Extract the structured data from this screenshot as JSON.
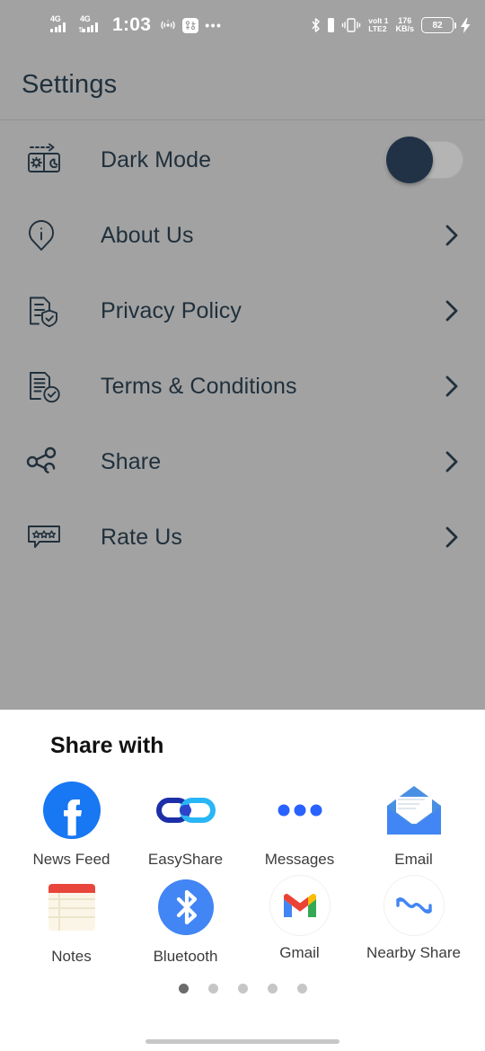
{
  "status_bar": {
    "network_type_1": "4G",
    "network_type_2": "4G",
    "time": "1:03",
    "hotspot_icon": "hotspot-icon",
    "filter_icon": "data-saver-icon",
    "overflow_icon": "more-dots-icon",
    "bluetooth_icon": "bluetooth-icon",
    "vibrate_icon": "vibrate-icon",
    "volte_line1": "volt 1",
    "volte_line2": "LTE2",
    "speed_value": "176",
    "speed_unit": "KB/s",
    "battery_level": "82",
    "charging_icon": "charging-bolt-icon"
  },
  "header": {
    "title": "Settings"
  },
  "settings": {
    "items": [
      {
        "label": "Dark Mode",
        "icon": "dark-mode-icon",
        "control": "toggle",
        "toggle_on": false
      },
      {
        "label": "About Us",
        "icon": "info-pin-icon",
        "control": "chevron"
      },
      {
        "label": "Privacy Policy",
        "icon": "privacy-shield-icon",
        "control": "chevron"
      },
      {
        "label": "Terms & Conditions",
        "icon": "terms-check-icon",
        "control": "chevron"
      },
      {
        "label": "Share",
        "icon": "share-nodes-icon",
        "control": "chevron"
      },
      {
        "label": "Rate Us",
        "icon": "rate-stars-icon",
        "control": "chevron"
      }
    ]
  },
  "share_sheet": {
    "title": "Share with",
    "targets": [
      {
        "label": "News Feed",
        "icon": "facebook-icon"
      },
      {
        "label": "EasyShare",
        "icon": "easyshare-icon"
      },
      {
        "label": "Messages",
        "icon": "messages-dots-icon"
      },
      {
        "label": "Email",
        "icon": "email-envelope-icon"
      },
      {
        "label": "Notes",
        "icon": "notes-icon"
      },
      {
        "label": "Bluetooth",
        "icon": "bluetooth-circle-icon"
      },
      {
        "label": "Gmail",
        "icon": "gmail-icon"
      },
      {
        "label": "Nearby Share",
        "icon": "nearby-share-icon"
      }
    ],
    "page_count": 5,
    "active_page": 1
  },
  "colors": {
    "dim_background": "#a2a2a2",
    "text_dark": "#20303c",
    "toggle_knob": "#213246",
    "toggle_track": "#b4b4b4",
    "facebook_blue": "#1877F2",
    "bluetooth_blue": "#4285F4",
    "email_blue": "#4A90E2",
    "notes_red": "#E8453C",
    "sheet_background": "#ffffff"
  }
}
